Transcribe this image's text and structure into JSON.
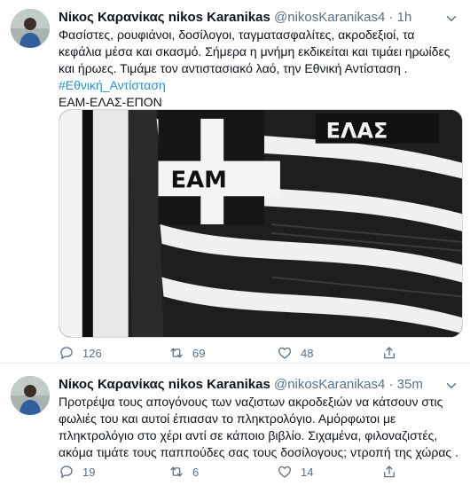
{
  "tweets": [
    {
      "author_name": "Νίκος Καρανίκας nikos Karanikas",
      "handle": "@nikosKaranikas4",
      "time": "1h",
      "separator": "·",
      "text_lines": [
        "Φασίστες, ρουφιάνοι,  δοσίλογοι, ταγματασφαλίτες, ακροδεξιοί, τα",
        "κεφάλια μέσα και σκασμό. Σήμερα η μνήμη εκδικείται και τιμάει ηρωίδες",
        "και ήρωες. Τιμάμε τον αντιστασιακό λαό, την Εθνική Αντίσταση ."
      ],
      "hashtag": "#Εθνική_Αντίσταση",
      "extra_line": "ΕΑΜ-ΕΛΑΣ-ΕΠΟΝ",
      "image_text": {
        "top_label": "ΕΛΑΣ",
        "cross_label": "ΕΑΜ"
      },
      "replies": "126",
      "retweets": "69",
      "likes": "48"
    },
    {
      "author_name": "Νίκος Καρανίκας nikos Karanikas",
      "handle": "@nikosKaranikas4",
      "time": "35m",
      "separator": "·",
      "text_lines": [
        "Προτρέψα τους απογόνους των ναζιστων ακροδεξιών να κάτσουν στις",
        "φωλιές του και αυτοί έπιασαν το πληκτρολόγιο. Αμόρφωτοι με",
        "πληκτρολόγιο στο χέρι αντί σε κάποιο βιβλίο. Σιχαμένα, φιλοναζιστές,",
        "ακόμα τιμάτε τους παππούδες σας τους δοσίλογους; ντροπή της χώρας ."
      ],
      "replies": "19",
      "retweets": "6",
      "likes": "14"
    }
  ],
  "icons": {
    "reply": "reply-icon",
    "retweet": "retweet-icon",
    "like": "heart-icon",
    "share": "share-icon",
    "more": "chevron-down-icon"
  },
  "colors": {
    "text": "#0f1419",
    "secondary": "#5b7083",
    "link": "#1b95e0",
    "divider": "#e6ecf0"
  }
}
